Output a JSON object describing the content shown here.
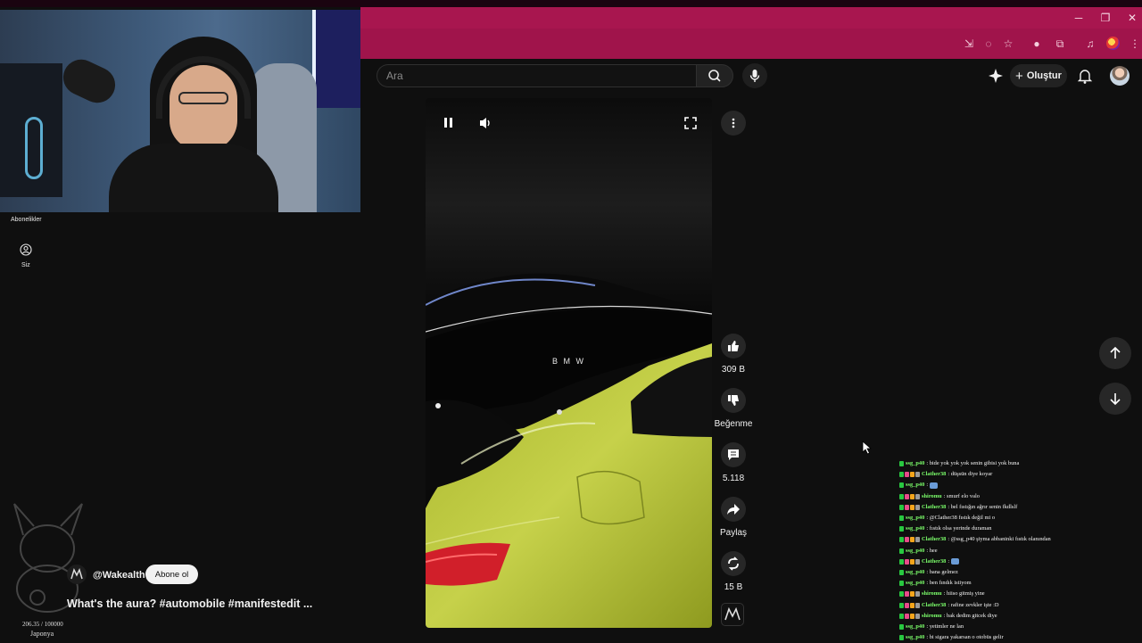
{
  "youtube": {
    "search": {
      "placeholder": "Ara"
    },
    "create_label": "Oluştur"
  },
  "sidebar": {
    "items": [
      {
        "label": "Abonelikler",
        "icon": "subscriptions-icon"
      },
      {
        "label": "Siz",
        "icon": "user-circle-icon"
      }
    ]
  },
  "video": {
    "brand_text": "B M W",
    "controls": [
      "pause-icon",
      "volume-icon",
      "fullscreen-icon"
    ]
  },
  "actions": {
    "like_count": "309 B",
    "dislike_label": "Beğenme",
    "comments_count": "5.118",
    "share_label": "Paylaş",
    "remix_count": "15 B"
  },
  "channel": {
    "handle": "@Wakealth",
    "subscribe_label": "Abone ol"
  },
  "title": "What's the aura? #automobile #manifestedit ...",
  "overlay": {
    "counter": "206.35 / 100000",
    "counter_label": "Japonya"
  },
  "chat": [
    {
      "user": "ssg_p40",
      "color": "#7cff6b",
      "badges": [
        "#28c840"
      ],
      "message": "bide yok yok yok senin gibisi yok buna"
    },
    {
      "user": "Clather38",
      "color": "#7cff6b",
      "badges": [
        "#28c840",
        "#e84b8a",
        "#f4a51c",
        "#9a9a9a"
      ],
      "message": "düşsün diye koyar"
    },
    {
      "user": "ssg_p40",
      "color": "#7cff6b",
      "badges": [
        "#28c840"
      ],
      "message": "",
      "emote": true
    },
    {
      "user": "shiromu",
      "color": "#7cff6b",
      "badges": [
        "#28c840",
        "#e84b8a",
        "#f4a51c",
        "#9a9a9a"
      ],
      "message": "smurf elo valo"
    },
    {
      "user": "Clather38",
      "color": "#7cff6b",
      "badges": [
        "#28c840",
        "#e84b8a",
        "#f4a51c",
        "#9a9a9a"
      ],
      "message": "bel fıstığın ağrır senin fkdlslf"
    },
    {
      "user": "ssg_p40",
      "color": "#7cff6b",
      "badges": [
        "#28c840"
      ],
      "message": "@Clather38 fıstık değil mi o"
    },
    {
      "user": "ssg_p40",
      "color": "#7cff6b",
      "badges": [
        "#28c840"
      ],
      "message": "fıstık olsa yerinde duraman"
    },
    {
      "user": "Clather38",
      "color": "#7cff6b",
      "badges": [
        "#28c840",
        "#e84b8a",
        "#f4a51c",
        "#9a9a9a"
      ],
      "message": "@ssg_p40 şiyma abbaninki fıstık olanından"
    },
    {
      "user": "ssg_p40",
      "color": "#7cff6b",
      "badges": [
        "#28c840"
      ],
      "message": "hee"
    },
    {
      "user": "Clather38",
      "color": "#7cff6b",
      "badges": [
        "#28c840",
        "#e84b8a",
        "#f4a51c",
        "#9a9a9a"
      ],
      "message": "",
      "emote": true
    },
    {
      "user": "ssg_p40",
      "color": "#7cff6b",
      "badges": [
        "#28c840"
      ],
      "message": "bana gelmez"
    },
    {
      "user": "ssg_p40",
      "color": "#7cff6b",
      "badges": [
        "#28c840"
      ],
      "message": "ben fındık istiyom"
    },
    {
      "user": "shiromu",
      "color": "#7cff6b",
      "badges": [
        "#28c840",
        "#e84b8a",
        "#f4a51c",
        "#9a9a9a"
      ],
      "message": "hiiso gitmiş yine"
    },
    {
      "user": "Clather38",
      "color": "#7cff6b",
      "badges": [
        "#28c840",
        "#e84b8a",
        "#f4a51c",
        "#9a9a9a"
      ],
      "message": "rafine zevkler işte :D"
    },
    {
      "user": "shiromu",
      "color": "#7cff6b",
      "badges": [
        "#28c840",
        "#e84b8a",
        "#f4a51c",
        "#9a9a9a"
      ],
      "message": "bak dedim gitcek diye"
    },
    {
      "user": "ssg_p40",
      "color": "#7cff6b",
      "badges": [
        "#28c840"
      ],
      "message": "yetimler ne lan"
    },
    {
      "user": "ssg_p40",
      "color": "#7cff6b",
      "badges": [
        "#28c840"
      ],
      "message": "bi sigara yakarsan o otobüs gelir"
    }
  ],
  "colors": {
    "browser_accent": "#a8164f",
    "background": "#0f0f0f",
    "car": "#b7c33a"
  }
}
